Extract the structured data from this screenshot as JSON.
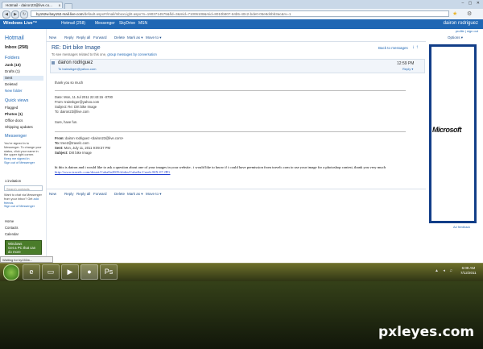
{
  "browser": {
    "tab_title": "Hotmail - dairon23@live.co...",
    "tab_close": "x",
    "url_host": "by152w.bay152.mail.live.com",
    "url_path": "/default.aspx#!/mail/InboxLight.aspx?n=1903714575&fid=3&mid=71006108&mid=8010b807-64b5-40c2-bde0-05e8d4bb3ac&rv=1",
    "back": "◀",
    "forward": "▶",
    "reload": "↻"
  },
  "header": {
    "logo": "Windows Live™",
    "nav": [
      "Hotmail (258)",
      "Messenger",
      "SkyDrive",
      "MSN"
    ],
    "username": "dairon rodriguez",
    "profile": "profile | sign out"
  },
  "sidebar": {
    "brand": "Hotmail",
    "inbox": "Inbox (258)",
    "folders_heading": "Folders",
    "folders": [
      "Junk (10)",
      "Drafts (1)",
      "Sent",
      "Deleted",
      "New folder"
    ],
    "quickviews_heading": "Quick views",
    "quickviews": [
      "Flagged",
      "Photos (1)",
      "Office docs",
      "Shipping updates"
    ],
    "messenger_heading": "Messenger",
    "messenger_text": "You're signed in to Messenger. To change your status, click your name in the upper right corner.",
    "messenger_links": [
      "Keep me signed in",
      "Sign out of Messenger"
    ],
    "invitation": "1 invitation",
    "search_placeholder": "Search contacts",
    "chat_text": "Want to chat via Messenger from your inbox? Get",
    "chat_link_add": "add friends",
    "chat_link_signout": "Sign out of Messenger",
    "bottom_links": [
      "Home",
      "Contacts",
      "Calendar"
    ],
    "win_ad_title": "Windows",
    "win_ad_text": "Get a PC that can do more",
    "status": "Waiting for by152w..."
  },
  "toolbar": {
    "items": [
      "New",
      "Reply",
      "Reply all",
      "Forward",
      "Delete",
      "Mark as ▾",
      "Move to ▾"
    ],
    "options": "Options ▾"
  },
  "message": {
    "subject": "RE: Dirt bike Image",
    "note_prefix": "To see messages related to this one,",
    "note_link": "group messages by conversation",
    "back": "Back to messages",
    "sender": "dairon rodriguez",
    "to": "To trainsikger@yahoo.com",
    "time": "12:59 PM",
    "reply": "Reply ▾",
    "lines": [
      "thank you so much",
      "Date: Mon, 11 Jul 2011 22:43:15 -0700",
      "From: trainskger@yahoo.com",
      "Subject: Re: Dirt bike Image",
      "To: dairon23@live.com",
      "Sure, have fun."
    ],
    "quoted": {
      "from_label": "From:",
      "from": "dairon rodriguez <dairon23@live.com>",
      "to_label": "To:",
      "to": "tree2@travelc.com",
      "sent_label": "Sent:",
      "sent": "Mon, July 11, 2011 9:09:37 PM",
      "subject_label": "Subject:",
      "subject": "Dirt bike Image"
    },
    "body": "hi this is dairon and i would like to ask a question about one of your images in your website.. i would like to know if i could have premission from travelc.com to use your image for a photoshop contest, thank you very much",
    "body_link": "http://www.travelc.com/desert/Caballa2005/slides/Caballa-Creek-MX-07.JPG"
  },
  "ad": {
    "brand": "Microsoft",
    "feedback": "Ad feedback"
  },
  "taskbar": {
    "time": "6:08 AM",
    "date": "7/12/2011"
  },
  "watermark": "pxleyes.com"
}
